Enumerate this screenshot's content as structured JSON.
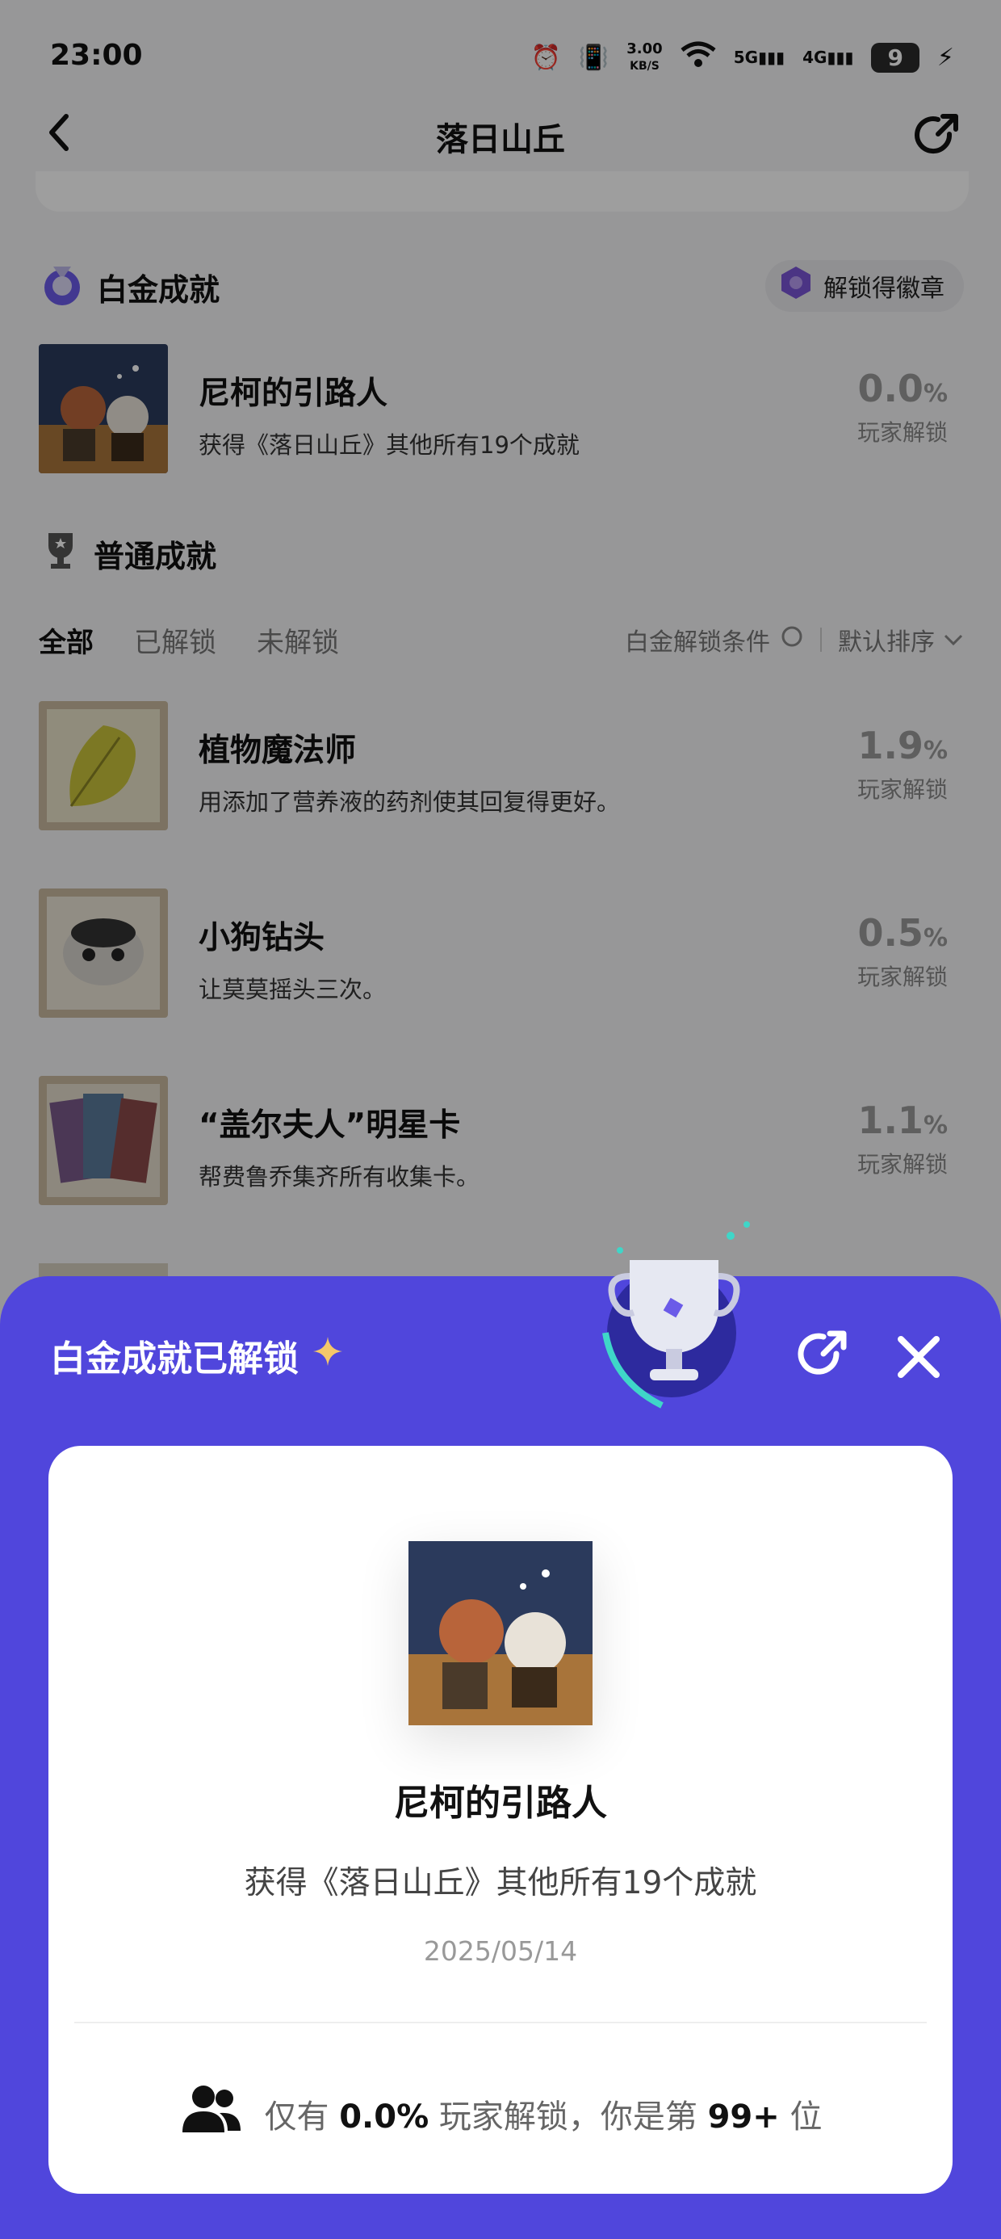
{
  "status": {
    "time": "23:00",
    "net_speed_value": "3.00",
    "net_speed_unit": "KB/S",
    "signal1": "5G",
    "signal2": "4G",
    "battery": "9"
  },
  "nav": {
    "title": "落日山丘"
  },
  "platinum": {
    "section_title": "白金成就",
    "badge_label": "解锁得徽章",
    "item": {
      "title": "尼柯的引路人",
      "desc": "获得《落日山丘》其他所有19个成就",
      "pct": "0.0",
      "pct_unit": "%",
      "pct_label": "玩家解锁"
    }
  },
  "normal": {
    "section_title": "普通成就",
    "filters": [
      "全部",
      "已解锁",
      "未解锁"
    ],
    "platinum_condition": "白金解锁条件",
    "sort": "默认排序",
    "items": [
      {
        "title": "植物魔法师",
        "desc": "用添加了营养液的药剂使其回复得更好。",
        "pct": "1.9",
        "pct_unit": "%",
        "pct_label": "玩家解锁"
      },
      {
        "title": "小狗钻头",
        "desc": "让莫莫摇头三次。",
        "pct": "0.5",
        "pct_unit": "%",
        "pct_label": "玩家解锁"
      },
      {
        "title": "“盖尔夫人”明星卡",
        "desc": "帮费鲁乔集齐所有收集卡。",
        "pct": "1.1",
        "pct_unit": "%",
        "pct_label": "玩家解锁"
      }
    ]
  },
  "sheet": {
    "title": "白金成就已解锁",
    "achievement_title": "尼柯的引路人",
    "achievement_desc": "获得《落日山丘》其他所有19个成就",
    "date": "2025/05/14",
    "stat_prefix": "仅有",
    "stat_pct": "0.0%",
    "stat_mid": "玩家解锁，你是第",
    "stat_rank": "99+",
    "stat_suffix": "位"
  },
  "colors": {
    "accent": "#5046dc",
    "sheet_bg": "#5046dc"
  },
  "icons": [
    "back-icon",
    "share-icon",
    "platinum-medal-icon",
    "trophy-icon",
    "close-icon",
    "users-icon",
    "star-icon",
    "chevron-down-icon"
  ]
}
